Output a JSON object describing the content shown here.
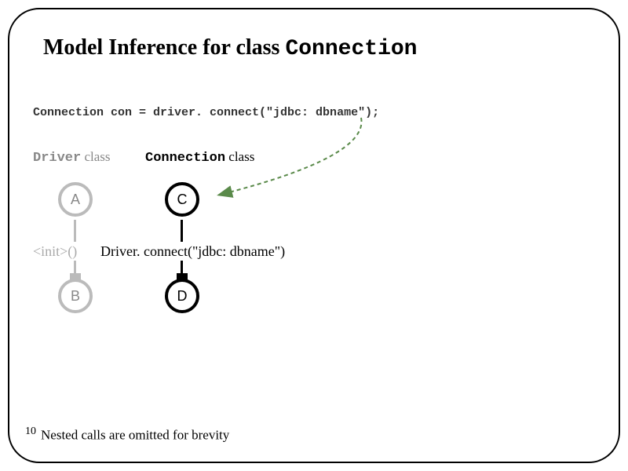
{
  "title_prefix": "Model Inference for class ",
  "title_mono": "Connection",
  "code_line": "Connection con = driver. connect(\"jdbc: dbname\");",
  "columns": {
    "driver": {
      "mono": "Driver",
      "suffix": " class"
    },
    "connection": {
      "mono": "Connection",
      "suffix": " class"
    }
  },
  "nodes": {
    "a": "A",
    "b": "B",
    "c": "C",
    "d": "D"
  },
  "edges": {
    "init": "<init>()",
    "driverconnect": "Driver. connect(\"jdbc: dbname\")"
  },
  "footer": {
    "num": "10",
    "text": "Nested calls are omitted for brevity"
  },
  "chart_data": {
    "type": "diagram",
    "title": "Model Inference for class Connection",
    "columns": [
      {
        "name": "Driver class",
        "faded": true,
        "nodes": [
          "A",
          "B"
        ],
        "edge": "<init>()"
      },
      {
        "name": "Connection class",
        "faded": false,
        "nodes": [
          "C",
          "D"
        ],
        "edge": "Driver.connect(\"jdbc:dbname\")"
      }
    ],
    "annotation_arrow": {
      "from": "code_line",
      "to": "C",
      "style": "dashed-green"
    },
    "footnote": "Nested calls are omitted for brevity"
  }
}
